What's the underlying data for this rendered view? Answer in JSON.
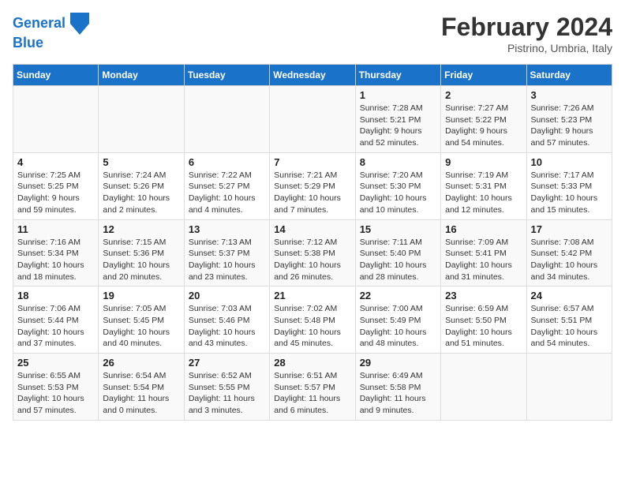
{
  "header": {
    "logo_line1": "General",
    "logo_line2": "Blue",
    "month": "February 2024",
    "location": "Pistrino, Umbria, Italy"
  },
  "days_of_week": [
    "Sunday",
    "Monday",
    "Tuesday",
    "Wednesday",
    "Thursday",
    "Friday",
    "Saturday"
  ],
  "weeks": [
    [
      {
        "day": "",
        "info": ""
      },
      {
        "day": "",
        "info": ""
      },
      {
        "day": "",
        "info": ""
      },
      {
        "day": "",
        "info": ""
      },
      {
        "day": "1",
        "info": "Sunrise: 7:28 AM\nSunset: 5:21 PM\nDaylight: 9 hours and 52 minutes."
      },
      {
        "day": "2",
        "info": "Sunrise: 7:27 AM\nSunset: 5:22 PM\nDaylight: 9 hours and 54 minutes."
      },
      {
        "day": "3",
        "info": "Sunrise: 7:26 AM\nSunset: 5:23 PM\nDaylight: 9 hours and 57 minutes."
      }
    ],
    [
      {
        "day": "4",
        "info": "Sunrise: 7:25 AM\nSunset: 5:25 PM\nDaylight: 9 hours and 59 minutes."
      },
      {
        "day": "5",
        "info": "Sunrise: 7:24 AM\nSunset: 5:26 PM\nDaylight: 10 hours and 2 minutes."
      },
      {
        "day": "6",
        "info": "Sunrise: 7:22 AM\nSunset: 5:27 PM\nDaylight: 10 hours and 4 minutes."
      },
      {
        "day": "7",
        "info": "Sunrise: 7:21 AM\nSunset: 5:29 PM\nDaylight: 10 hours and 7 minutes."
      },
      {
        "day": "8",
        "info": "Sunrise: 7:20 AM\nSunset: 5:30 PM\nDaylight: 10 hours and 10 minutes."
      },
      {
        "day": "9",
        "info": "Sunrise: 7:19 AM\nSunset: 5:31 PM\nDaylight: 10 hours and 12 minutes."
      },
      {
        "day": "10",
        "info": "Sunrise: 7:17 AM\nSunset: 5:33 PM\nDaylight: 10 hours and 15 minutes."
      }
    ],
    [
      {
        "day": "11",
        "info": "Sunrise: 7:16 AM\nSunset: 5:34 PM\nDaylight: 10 hours and 18 minutes."
      },
      {
        "day": "12",
        "info": "Sunrise: 7:15 AM\nSunset: 5:36 PM\nDaylight: 10 hours and 20 minutes."
      },
      {
        "day": "13",
        "info": "Sunrise: 7:13 AM\nSunset: 5:37 PM\nDaylight: 10 hours and 23 minutes."
      },
      {
        "day": "14",
        "info": "Sunrise: 7:12 AM\nSunset: 5:38 PM\nDaylight: 10 hours and 26 minutes."
      },
      {
        "day": "15",
        "info": "Sunrise: 7:11 AM\nSunset: 5:40 PM\nDaylight: 10 hours and 28 minutes."
      },
      {
        "day": "16",
        "info": "Sunrise: 7:09 AM\nSunset: 5:41 PM\nDaylight: 10 hours and 31 minutes."
      },
      {
        "day": "17",
        "info": "Sunrise: 7:08 AM\nSunset: 5:42 PM\nDaylight: 10 hours and 34 minutes."
      }
    ],
    [
      {
        "day": "18",
        "info": "Sunrise: 7:06 AM\nSunset: 5:44 PM\nDaylight: 10 hours and 37 minutes."
      },
      {
        "day": "19",
        "info": "Sunrise: 7:05 AM\nSunset: 5:45 PM\nDaylight: 10 hours and 40 minutes."
      },
      {
        "day": "20",
        "info": "Sunrise: 7:03 AM\nSunset: 5:46 PM\nDaylight: 10 hours and 43 minutes."
      },
      {
        "day": "21",
        "info": "Sunrise: 7:02 AM\nSunset: 5:48 PM\nDaylight: 10 hours and 45 minutes."
      },
      {
        "day": "22",
        "info": "Sunrise: 7:00 AM\nSunset: 5:49 PM\nDaylight: 10 hours and 48 minutes."
      },
      {
        "day": "23",
        "info": "Sunrise: 6:59 AM\nSunset: 5:50 PM\nDaylight: 10 hours and 51 minutes."
      },
      {
        "day": "24",
        "info": "Sunrise: 6:57 AM\nSunset: 5:51 PM\nDaylight: 10 hours and 54 minutes."
      }
    ],
    [
      {
        "day": "25",
        "info": "Sunrise: 6:55 AM\nSunset: 5:53 PM\nDaylight: 10 hours and 57 minutes."
      },
      {
        "day": "26",
        "info": "Sunrise: 6:54 AM\nSunset: 5:54 PM\nDaylight: 11 hours and 0 minutes."
      },
      {
        "day": "27",
        "info": "Sunrise: 6:52 AM\nSunset: 5:55 PM\nDaylight: 11 hours and 3 minutes."
      },
      {
        "day": "28",
        "info": "Sunrise: 6:51 AM\nSunset: 5:57 PM\nDaylight: 11 hours and 6 minutes."
      },
      {
        "day": "29",
        "info": "Sunrise: 6:49 AM\nSunset: 5:58 PM\nDaylight: 11 hours and 9 minutes."
      },
      {
        "day": "",
        "info": ""
      },
      {
        "day": "",
        "info": ""
      }
    ]
  ]
}
